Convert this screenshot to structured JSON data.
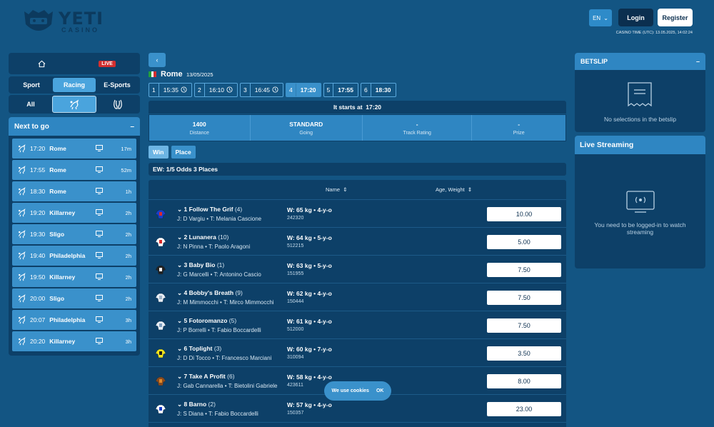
{
  "brand": {
    "name": "YETI",
    "sub": "CASINO"
  },
  "header": {
    "lang": "EN",
    "login": "Login",
    "register": "Register",
    "casino_time": "CASINO TIME (UTC): 13.05.2025, 14:02:24"
  },
  "sidebar": {
    "live": "LIVE",
    "tabs": [
      "Sport",
      "Racing",
      "E-Sports"
    ],
    "active_tab": "Racing",
    "filter_all": "All",
    "next_to_go": {
      "title": "Next to go",
      "collapse": "–",
      "items": [
        {
          "time": "17:20",
          "venue": "Rome",
          "mins": "17m"
        },
        {
          "time": "17:55",
          "venue": "Rome",
          "mins": "52m"
        },
        {
          "time": "18:30",
          "venue": "Rome",
          "mins": "1h"
        },
        {
          "time": "19:20",
          "venue": "Killarney",
          "mins": "2h"
        },
        {
          "time": "19:30",
          "venue": "Sligo",
          "mins": "2h"
        },
        {
          "time": "19:40",
          "venue": "Philadelphia",
          "mins": "2h"
        },
        {
          "time": "19:50",
          "venue": "Killarney",
          "mins": "2h"
        },
        {
          "time": "20:00",
          "venue": "Sligo",
          "mins": "2h"
        },
        {
          "time": "20:07",
          "venue": "Philadelphia",
          "mins": "3h"
        },
        {
          "time": "20:20",
          "venue": "Killarney",
          "mins": "3h"
        }
      ]
    }
  },
  "race": {
    "venue": "Rome",
    "date": "13/05/2025",
    "times": [
      {
        "n": "1",
        "t": "15:35",
        "done": true
      },
      {
        "n": "2",
        "t": "16:10",
        "done": true
      },
      {
        "n": "3",
        "t": "16:45",
        "done": true
      },
      {
        "n": "4",
        "t": "17:20",
        "selected": true
      },
      {
        "n": "5",
        "t": "17:55"
      },
      {
        "n": "6",
        "t": "18:30"
      }
    ],
    "starts_label": "It starts at",
    "starts_time": "17:20",
    "info": [
      {
        "value": "1400",
        "label": "Distance"
      },
      {
        "value": "STANDARD",
        "label": "Going"
      },
      {
        "value": "-",
        "label": "Track Rating"
      },
      {
        "value": "-",
        "label": "Prize"
      }
    ],
    "bet_tabs": [
      "Win",
      "Place"
    ],
    "ew": "EW: 1/5 Odds 3 Places",
    "col_name": "Name",
    "col_age": "Age, Weight",
    "runners": [
      {
        "name": "1 Follow The Grif",
        "draw": "(4)",
        "jt": "J: D Vargiu • T: Melania Cascione",
        "wt": "W: 65 kg • 4-y-o",
        "id": "242320",
        "odds": "10.00",
        "silk": "#1a3ec9",
        "silk2": "#d92a2a"
      },
      {
        "name": "2 Lunanera",
        "draw": "(10)",
        "jt": "J: N Pinna • T: Paolo Aragoni",
        "wt": "W: 64 kg • 5-y-o",
        "id": "512215",
        "odds": "5.00",
        "silk": "#ffffff",
        "silk2": "#d92a2a"
      },
      {
        "name": "3 Baby Bio",
        "draw": "(1)",
        "jt": "J: G Marcelli • T: Antonino Cascio",
        "wt": "W: 63 kg • 5-y-o",
        "id": "151955",
        "odds": "7.50",
        "silk": "#222222",
        "silk2": "#ffffff"
      },
      {
        "name": "4 Bobby's Breath",
        "draw": "(9)",
        "jt": "J: M Mimmocchi • T: Mirco Mimmocchi",
        "wt": "W: 62 kg • 4-y-o",
        "id": "150444",
        "odds": "7.50",
        "silk": "#e8eef5",
        "silk2": "#9fb4c9"
      },
      {
        "name": "5 Fotoromanzo",
        "draw": "(5)",
        "jt": "J: P Borrelli • T: Fabio Boccardelli",
        "wt": "W: 61 kg • 4-y-o",
        "id": "512000",
        "odds": "7.50",
        "silk": "#e8eef5",
        "silk2": "#7ea0c0"
      },
      {
        "name": "6 Toplight",
        "draw": "(3)",
        "jt": "J: D Di Tocco • T: Francesco Marciani",
        "wt": "W: 60 kg • 7-y-o",
        "id": "310094",
        "odds": "3.50",
        "silk": "#f2e21a",
        "silk2": "#1a1a1a"
      },
      {
        "name": "7 Take A Profit",
        "draw": "(6)",
        "jt": "J: Gab Cannarella • T: Bietolini Gabriele",
        "wt": "W: 58 kg • 4-y-o",
        "id": "423611",
        "odds": "8.00",
        "silk": "#8a4a1c",
        "silk2": "#e38b2a"
      },
      {
        "name": "8 Barno",
        "draw": "(2)",
        "jt": "J: S Diana • T: Fabio Boccardelli",
        "wt": "W: 57 kg • 4-y-o",
        "id": "150357",
        "odds": "23.00",
        "silk": "#ffffff",
        "silk2": "#1a3ec9"
      }
    ]
  },
  "betslip": {
    "title": "BETSLIP",
    "collapse": "–",
    "empty": "No selections in the betslip"
  },
  "streaming": {
    "title": "Live Streaming",
    "message": "You need to be logged-in to watch streaming"
  },
  "cookie": {
    "text": "We use cookies",
    "ok": "OK"
  },
  "colors": {
    "bg": "#135583",
    "panel": "#0d4068",
    "accent": "#2f86c2",
    "item": "#3a91cb",
    "live": "#d32f2f"
  }
}
